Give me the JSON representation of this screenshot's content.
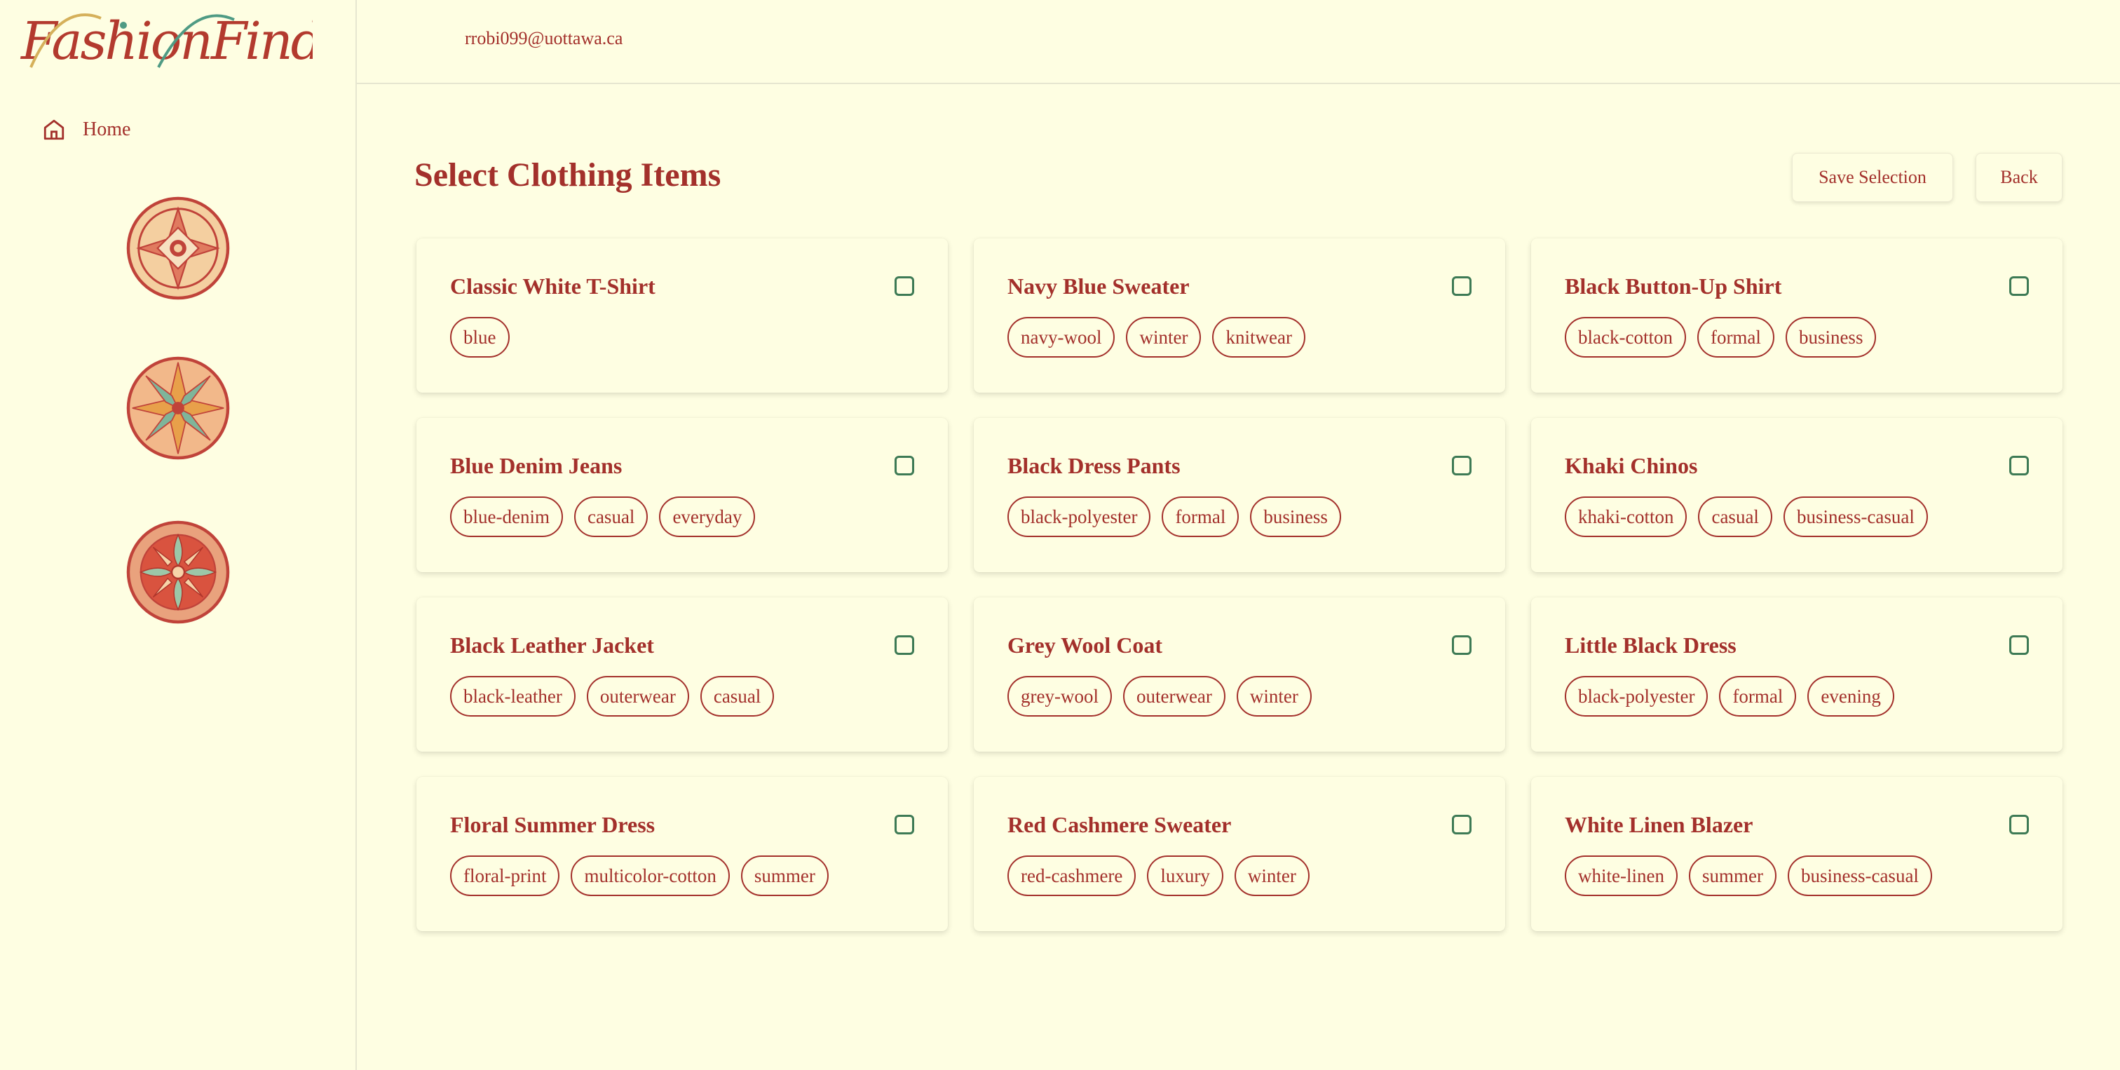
{
  "app": {
    "logo_text": "FashionFinders"
  },
  "sidebar": {
    "home_label": "Home"
  },
  "header": {
    "user_email": "rrobi099@uottawa.ca"
  },
  "main": {
    "title": "Select Clothing Items",
    "save_label": "Save Selection",
    "back_label": "Back"
  },
  "colors": {
    "background": "#fefee2",
    "accent": "#a3302b",
    "checkbox": "#3d7a55"
  },
  "items": [
    {
      "name": "Classic White T-Shirt",
      "checked": false,
      "tags": [
        "blue"
      ]
    },
    {
      "name": "Navy Blue Sweater",
      "checked": false,
      "tags": [
        "navy-wool",
        "winter",
        "knitwear"
      ]
    },
    {
      "name": "Black Button-Up Shirt",
      "checked": false,
      "tags": [
        "black-cotton",
        "formal",
        "business"
      ]
    },
    {
      "name": "Blue Denim Jeans",
      "checked": false,
      "tags": [
        "blue-denim",
        "casual",
        "everyday"
      ]
    },
    {
      "name": "Black Dress Pants",
      "checked": false,
      "tags": [
        "black-polyester",
        "formal",
        "business"
      ]
    },
    {
      "name": "Khaki Chinos",
      "checked": false,
      "tags": [
        "khaki-cotton",
        "casual",
        "business-casual"
      ]
    },
    {
      "name": "Black Leather Jacket",
      "checked": false,
      "tags": [
        "black-leather",
        "outerwear",
        "casual"
      ]
    },
    {
      "name": "Grey Wool Coat",
      "checked": false,
      "tags": [
        "grey-wool",
        "outerwear",
        "winter"
      ]
    },
    {
      "name": "Little Black Dress",
      "checked": false,
      "tags": [
        "black-polyester",
        "formal",
        "evening"
      ]
    },
    {
      "name": "Floral Summer Dress",
      "checked": false,
      "tags": [
        "floral-print",
        "multicolor-cotton",
        "summer"
      ]
    },
    {
      "name": "Red Cashmere Sweater",
      "checked": false,
      "tags": [
        "red-cashmere",
        "luxury",
        "winter"
      ]
    },
    {
      "name": "White Linen Blazer",
      "checked": false,
      "tags": [
        "white-linen",
        "summer",
        "business-casual"
      ]
    }
  ]
}
